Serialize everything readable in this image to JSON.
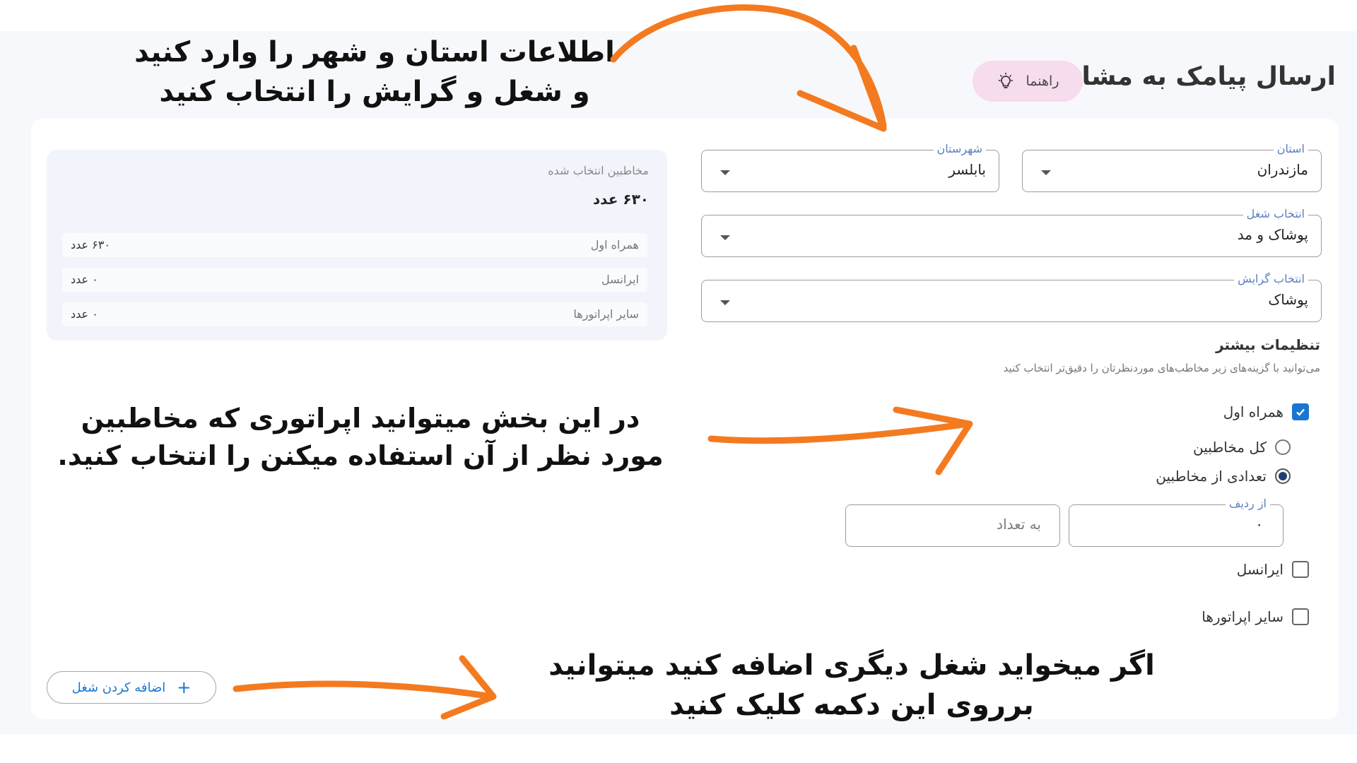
{
  "page": {
    "title": "ارسال پیامک به مشاغل",
    "guide_label": "راهنما"
  },
  "annotations": {
    "top_line1": "اطلاعات استان و شهر را وارد کنید",
    "top_line2": "و شغل و گرایش را انتخاب کنید",
    "middle_line1": "در این بخش میتوانید اپراتوری که مخاطبین",
    "middle_line2": "مورد نظر از آن استفاده میکنن را انتخاب کنید.",
    "bottom_line1": "اگر میخواید شغل دیگری اضافه کنید میتوانید",
    "bottom_line2": "برروی این دکمه کلیک کنید"
  },
  "form": {
    "province": {
      "label": "استان",
      "value": "مازندران"
    },
    "city": {
      "label": "شهرستان",
      "value": "بابلسر"
    },
    "job": {
      "label": "انتخاب شغل",
      "value": "پوشاک و مد"
    },
    "specialty": {
      "label": "انتخاب گرایش",
      "value": "پوشاک"
    }
  },
  "advanced": {
    "title": "تنظیمات بیشتر",
    "description": "می‌توانید با گزینه‌های زیر مخاطب‌های موردنظرتان را دقیق‌تر انتخاب کنید",
    "operators": [
      {
        "label": "همراه اول",
        "checked": true
      },
      {
        "label": "ایرانسل",
        "checked": false
      },
      {
        "label": "سایر اپراتورها",
        "checked": false
      }
    ],
    "radio_all": {
      "label": "کل مخاطبین",
      "selected": false
    },
    "radio_count": {
      "label": "تعدادی از مخاطبین",
      "selected": true
    },
    "from_row": {
      "label": "از ردیف",
      "value": "۰"
    },
    "count": {
      "placeholder": "به تعداد"
    }
  },
  "summary": {
    "header": "مخاطبین انتخاب شده",
    "total": "۶۳۰ عدد",
    "rows": [
      {
        "name": "همراه اول",
        "count": "۶۳۰ عدد"
      },
      {
        "name": "ایرانسل",
        "count": "۰ عدد"
      },
      {
        "name": "سایر اپراتورها",
        "count": "۰ عدد"
      }
    ]
  },
  "add_job": {
    "label": "اضافه کردن شغل",
    "icon": "plus-icon"
  },
  "colors": {
    "accent": "#1976d2",
    "label_blue": "#5c7fc0",
    "guide_bg": "#f6dcec",
    "summary_bg": "#f1f5fb",
    "arrow": "#f47a20"
  }
}
